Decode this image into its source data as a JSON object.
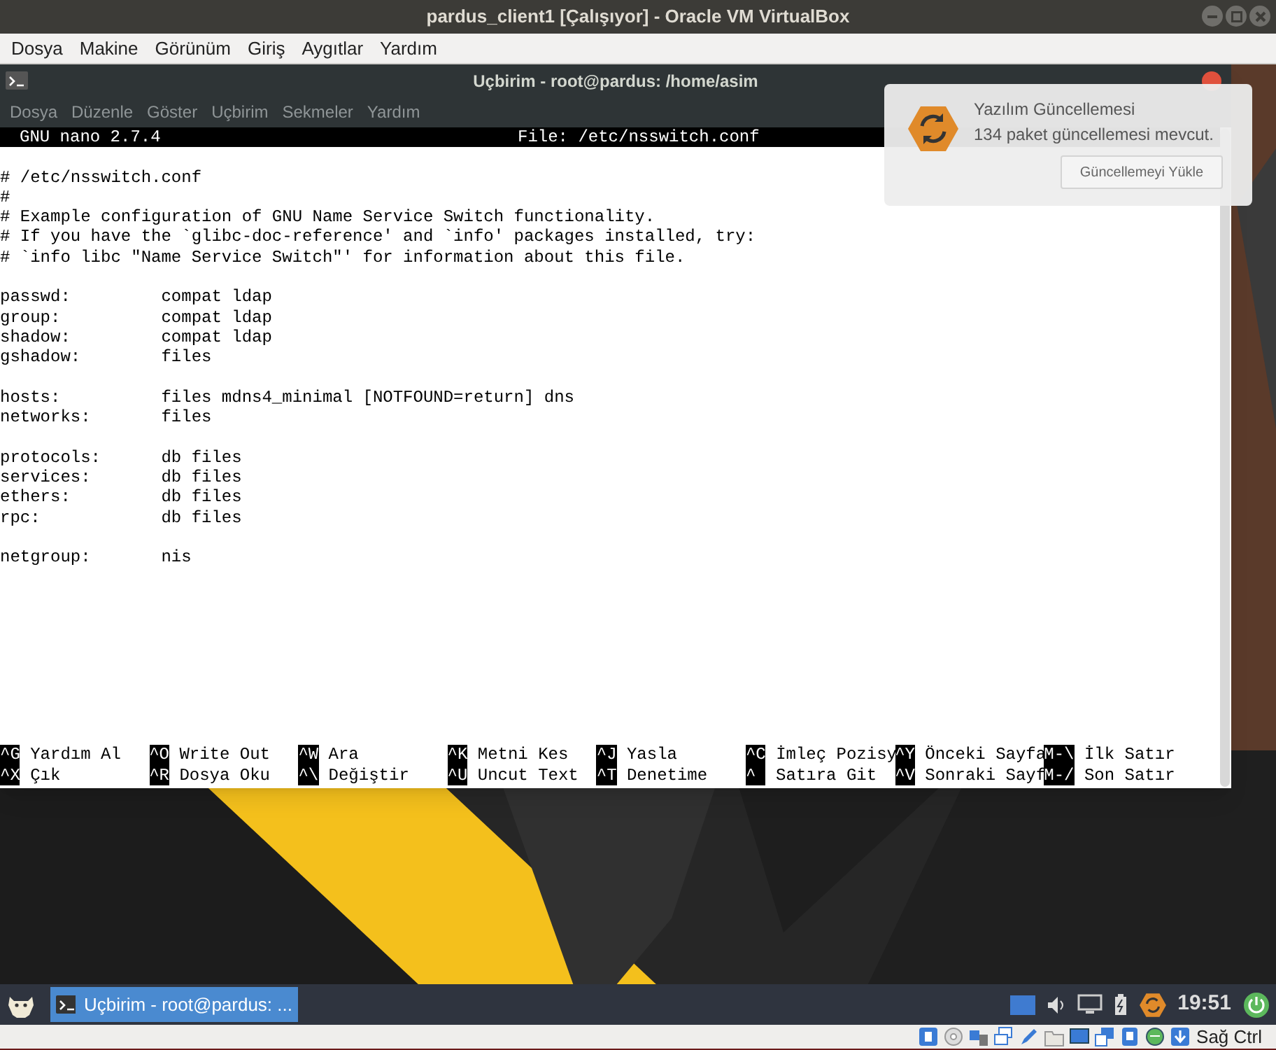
{
  "vm_window": {
    "title": "pardus_client1 [Çalışıyor] - Oracle VM VirtualBox",
    "menu": [
      "Dosya",
      "Makine",
      "Görünüm",
      "Giriş",
      "Aygıtlar",
      "Yardım"
    ]
  },
  "terminal": {
    "title": "Uçbirim - root@pardus: /home/asim",
    "menu": [
      "Dosya",
      "Düzenle",
      "Göster",
      "Uçbirim",
      "Sekmeler",
      "Yardım"
    ],
    "nano": {
      "version": "GNU nano 2.7.4",
      "file": "File: /etc/nsswitch.conf",
      "blocks": [
        [
          "# /etc/nsswitch.conf",
          "#",
          "# Example configuration of GNU Name Service Switch functionality.",
          "# If you have the `glibc-doc-reference' and `info' packages installed, try:",
          "# `info libc \"Name Service Switch\"' for information about this file."
        ],
        [
          "passwd:         compat ldap",
          "group:          compat ldap",
          "shadow:         compat ldap",
          "gshadow:        files"
        ],
        [
          "hosts:          files mdns4_minimal [NOTFOUND=return] dns",
          "networks:       files"
        ],
        [
          "protocols:      db files",
          "services:       db files",
          "ethers:         db files",
          "rpc:            db files"
        ],
        [
          "netgroup:       nis"
        ]
      ],
      "shortcuts": [
        [
          {
            "key": "^G",
            "label": "Yardım Al"
          },
          {
            "key": "^O",
            "label": "Write Out"
          },
          {
            "key": "^W",
            "label": "Ara"
          },
          {
            "key": "^K",
            "label": "Metni Kes"
          },
          {
            "key": "^J",
            "label": "Yasla"
          },
          {
            "key": "^C",
            "label": "İmleç Pozisy"
          },
          {
            "key": "^Y",
            "label": "Önceki Sayfa"
          },
          {
            "key": "M-\\",
            "label": "İlk Satır"
          }
        ],
        [
          {
            "key": "^X",
            "label": "Çık"
          },
          {
            "key": "^R",
            "label": "Dosya Oku"
          },
          {
            "key": "^\\",
            "label": "Değiştir"
          },
          {
            "key": "^U",
            "label": "Uncut Text"
          },
          {
            "key": "^T",
            "label": "Denetime"
          },
          {
            "key": "^",
            "label": "Satıra Git"
          },
          {
            "key": "^V",
            "label": "Sonraki Sayf"
          },
          {
            "key": "M-/",
            "label": "Son Satır"
          }
        ]
      ]
    }
  },
  "notification": {
    "title": "Yazılım Güncellemesi",
    "message": "134 paket güncellemesi mevcut.",
    "button": "Güncellemeyi Yükle"
  },
  "taskbar": {
    "task": "Uçbirim - root@pardus: ...",
    "clock": "19:51"
  },
  "status_bar": {
    "host_key": "Sağ Ctrl"
  }
}
